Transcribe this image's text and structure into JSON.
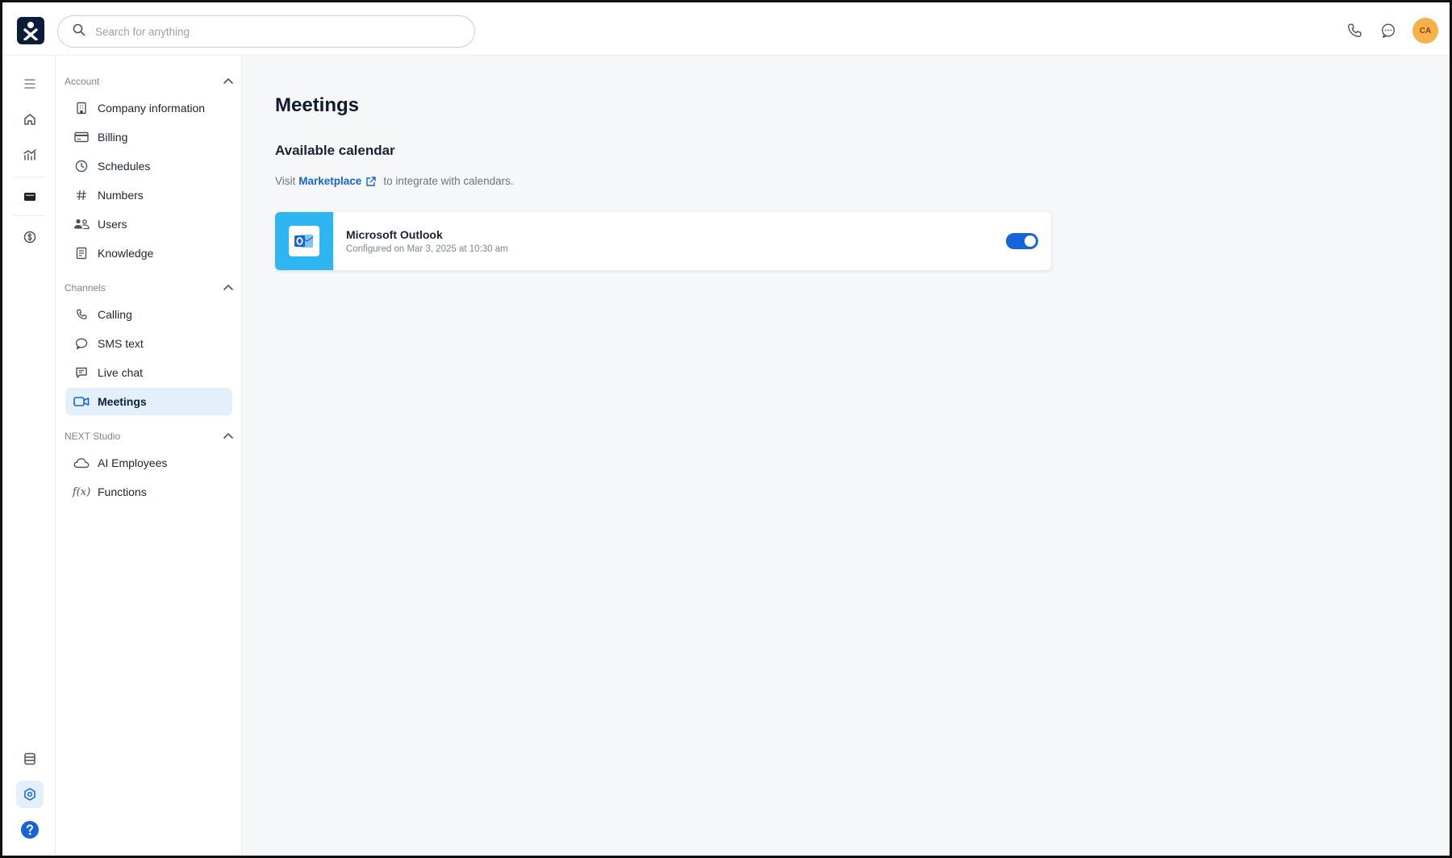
{
  "search": {
    "placeholder": "Search for anything"
  },
  "user": {
    "initials": "CA"
  },
  "colors": {
    "accent": "#1565d8",
    "active_bg": "#e3f0fb",
    "outlook_tile": "#2eb6f3",
    "avatar": "#f8b04a",
    "logo_bg": "#0b1d3a"
  },
  "rail": {
    "items": [
      {
        "icon": "menu-icon"
      },
      {
        "icon": "home-icon"
      },
      {
        "icon": "analytics-icon"
      },
      {
        "icon": "inbox-icon"
      },
      {
        "icon": "dollar-icon"
      },
      {
        "icon": "database-icon"
      },
      {
        "icon": "settings-hexagon-icon"
      },
      {
        "icon": "help-icon"
      }
    ]
  },
  "sidebar": {
    "sections": [
      {
        "title": "Account",
        "items": [
          {
            "label": "Company information",
            "icon": "building-icon"
          },
          {
            "label": "Billing",
            "icon": "credit-card-icon"
          },
          {
            "label": "Schedules",
            "icon": "clock-icon"
          },
          {
            "label": "Numbers",
            "icon": "hash-icon"
          },
          {
            "label": "Users",
            "icon": "users-icon"
          },
          {
            "label": "Knowledge",
            "icon": "book-icon"
          }
        ]
      },
      {
        "title": "Channels",
        "items": [
          {
            "label": "Calling",
            "icon": "phone-icon"
          },
          {
            "label": "SMS text",
            "icon": "chat-bubble-icon"
          },
          {
            "label": "Live chat",
            "icon": "live-chat-icon"
          },
          {
            "label": "Meetings",
            "icon": "video-icon",
            "active": true
          }
        ]
      },
      {
        "title": "NEXT Studio",
        "items": [
          {
            "label": "AI Employees",
            "icon": "cloud-icon"
          },
          {
            "label": "Functions",
            "icon": "function-icon"
          }
        ]
      }
    ]
  },
  "main": {
    "title": "Meetings",
    "subtitle": "Available calendar",
    "hint_prefix": "Visit",
    "hint_link": "Marketplace",
    "hint_suffix": "to integrate with calendars.",
    "integration": {
      "name": "Microsoft Outlook",
      "meta": "Configured on Mar 3, 2025 at 10:30 am",
      "enabled": true
    }
  }
}
